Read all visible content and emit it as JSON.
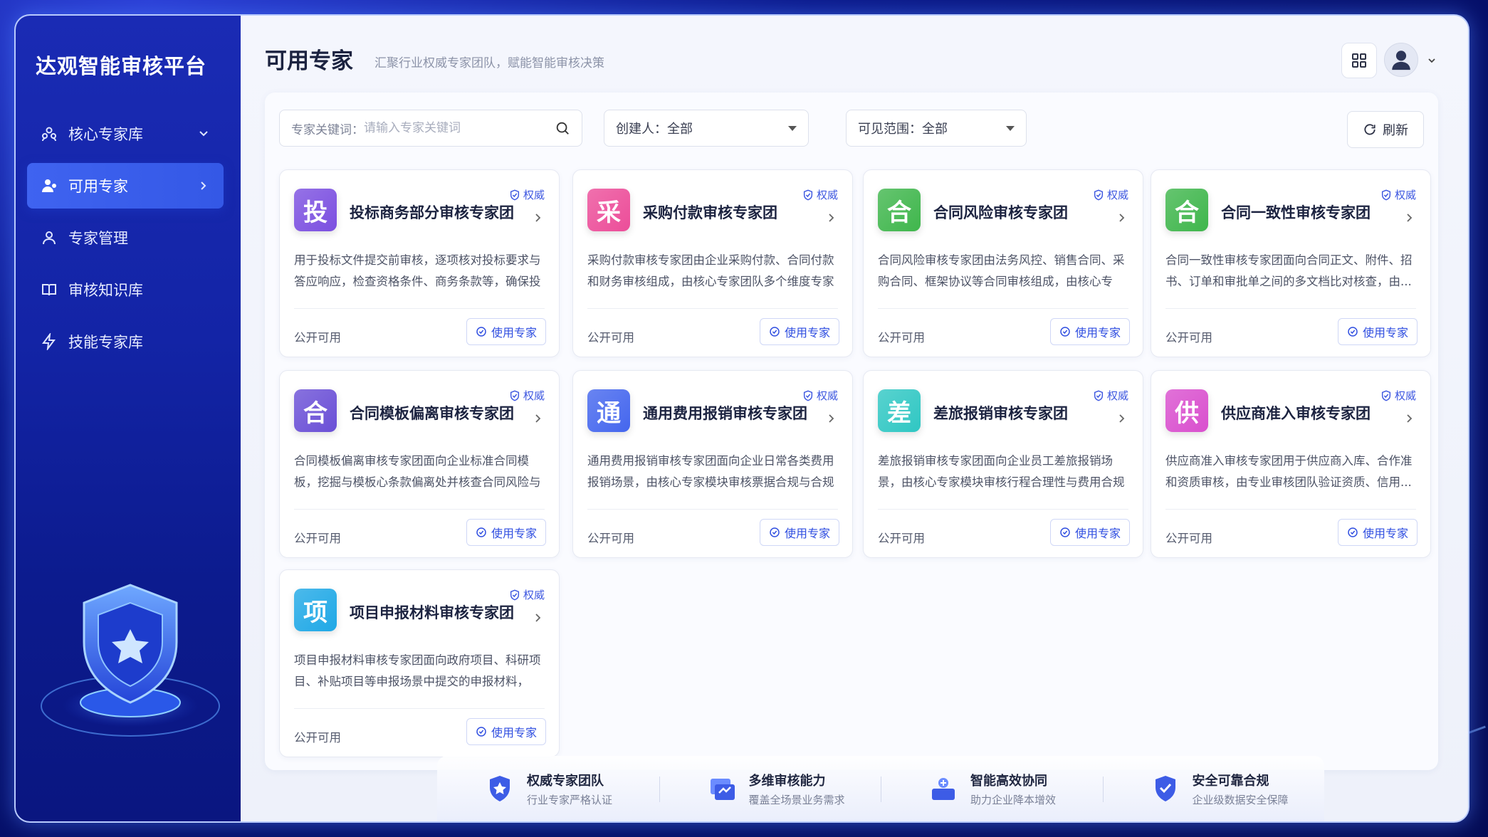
{
  "sidebar": {
    "brand": "达观智能审核平台",
    "items": [
      {
        "label": "核心专家库",
        "icon": "expert-group-icon",
        "active": false
      },
      {
        "label": "可用专家",
        "icon": "expert-user-icon",
        "active": true
      },
      {
        "label": "专家管理",
        "icon": "user-icon",
        "active": false
      },
      {
        "label": "审核知识库",
        "icon": "book-icon",
        "active": false
      },
      {
        "label": "技能专家库",
        "icon": "lightning-icon",
        "active": false
      }
    ]
  },
  "header": {
    "title": "可用专家",
    "subtitle": "汇聚行业权威专家团队，赋能智能审核决策"
  },
  "filters": {
    "search_label": "专家关键词：",
    "search_placeholder": "请输入专家关键词",
    "creator_label": "创建人：",
    "creator_value": "全部",
    "scope_label": "可见范围：",
    "scope_value": "全部",
    "refresh_label": "刷新"
  },
  "cards": [
    {
      "char": "投",
      "color": "#7b4fe0",
      "title": "投标商务部分审核专家团",
      "tag": "权威",
      "desc": "用于投标文件提交前审核，逐项核对投标要求与答应响应，检查资格条件、商务条款等，确保投标...",
      "status": "公开可用",
      "action": "使用专家"
    },
    {
      "char": "采",
      "color": "#ec4d99",
      "title": "采购付款审核专家团",
      "tag": "权威",
      "desc": "采购付款审核专家团由企业采购付款、合同付款和财务审核组成，由核心专家团队多个维度专家对...",
      "status": "公开可用",
      "action": "使用专家"
    },
    {
      "char": "合",
      "color": "#3fb64c",
      "title": "合同风险审核专家团",
      "tag": "权威",
      "desc": "合同风险审核专家团由法务风控、销售合同、采购合同、框架协议等合同审核组成，由核心专家...",
      "status": "公开可用",
      "action": "使用专家"
    },
    {
      "char": "合",
      "color": "#3fb64c",
      "title": "合同一致性审核专家团",
      "tag": "权威",
      "desc": "合同一致性审核专家团面向合同正文、附件、招书、订单和审批单之间的多文档比对核查，由...",
      "status": "公开可用",
      "action": "使用专家"
    },
    {
      "char": "合",
      "color": "#6a4fd6",
      "title": "合同模板偏离审核专家团",
      "tag": "权威",
      "desc": "合同模板偏离审核专家团面向企业标准合同模板，挖掘与模板心条款偏离处并核查合同风险与责任...",
      "status": "公开可用",
      "action": "使用专家"
    },
    {
      "char": "通",
      "color": "#4466ee",
      "title": "通用费用报销审核专家团",
      "tag": "权威",
      "desc": "通用费用报销审核专家团面向企业日常各类费用报销场景，由核心专家模块审核票据合规与合规性...",
      "status": "公开可用",
      "action": "使用专家"
    },
    {
      "char": "差",
      "color": "#2fc7c3",
      "title": "差旅报销审核专家团",
      "tag": "权威",
      "desc": "差旅报销审核专家团面向企业员工差旅报销场景，由核心专家模块审核行程合理性与费用合规性...",
      "status": "公开可用",
      "action": "使用专家"
    },
    {
      "char": "供",
      "color": "#d94fce",
      "title": "供应商准入审核专家团",
      "tag": "权威",
      "desc": "供应商准入审核专家团用于供应商入库、合作准和资质审核，由专业审核团队验证资质、信用...",
      "status": "公开可用",
      "action": "使用专家"
    },
    {
      "char": "项",
      "color": "#1fa8e6",
      "title": "项目申报材料审核专家团",
      "tag": "权威",
      "desc": "项目申报材料审核专家团面向政府项目、科研项目、补贴项目等申报场景中提交的申报材料，由...",
      "status": "公开可用",
      "action": "使用专家"
    }
  ],
  "features": [
    {
      "title": "权威专家团队",
      "sub": "行业专家严格认证",
      "icon": "shield-star-icon"
    },
    {
      "title": "多维审核能力",
      "sub": "覆盖全场景业务需求",
      "icon": "multi-dimension-icon"
    },
    {
      "title": "智能高效协同",
      "sub": "助力企业降本增效",
      "icon": "collaboration-icon"
    },
    {
      "title": "安全可靠合规",
      "sub": "企业级数据安全保障",
      "icon": "shield-check-icon"
    }
  ]
}
